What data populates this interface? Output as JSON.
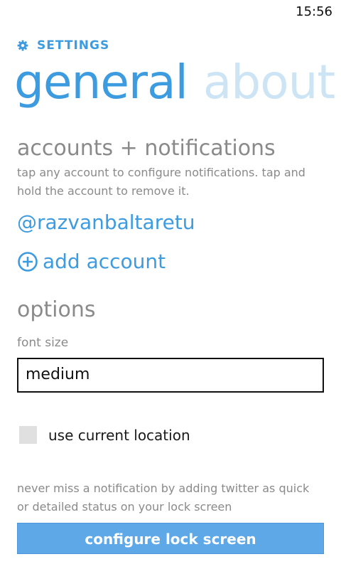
{
  "status_bar": {
    "time": "15:56"
  },
  "app": {
    "title": "SETTINGS",
    "icon": "gear-icon",
    "accent_color": "#3d9be0"
  },
  "pivot": {
    "tabs": [
      {
        "label": "general",
        "active": true
      },
      {
        "label": "about",
        "active": false
      }
    ]
  },
  "accounts": {
    "heading": "accounts + notifications",
    "description": "tap any account to configure notifications. tap and hold the account to remove it.",
    "items": [
      {
        "name": "@razvanbaltaretu"
      }
    ],
    "add_label": "add account",
    "add_icon": "plus-circle-icon"
  },
  "options": {
    "heading": "options",
    "font_size": {
      "label": "font size",
      "value": "medium"
    },
    "location": {
      "label": "use current location",
      "checked": false
    }
  },
  "lock_screen": {
    "description": "never miss a notification by adding twitter as quick or detailed status on your lock screen",
    "button_label": "configure lock screen",
    "button_color": "#5fa8e8"
  }
}
